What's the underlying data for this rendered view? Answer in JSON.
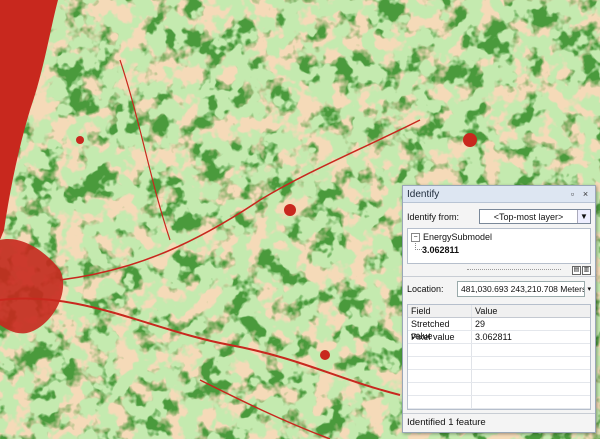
{
  "identify": {
    "title": "Identify",
    "identify_from_label": "Identify from:",
    "identify_from_value": "<Top-most layer>",
    "tree": {
      "layer": "EnergySubmodel",
      "value": "3.062811"
    },
    "location_label": "Location:",
    "location_value": "481,030.693  243,210.708 Meters",
    "columns": [
      "Field",
      "Value"
    ],
    "rows": [
      {
        "field": "Stretched value",
        "value": "29"
      },
      {
        "field": "Pixel value",
        "value": "3.062811"
      }
    ],
    "status": "Identified 1 feature"
  },
  "icons": {
    "minimize": "restore-icon",
    "close": "close-icon",
    "dropdown": "chevron-down-icon"
  },
  "colors": {
    "map_green": "#4a9a3c",
    "map_light_green": "#8ccf6e",
    "map_tan": "#e8b27a",
    "map_red": "#c8281e",
    "panel_title_bg": "#dde6f2"
  }
}
